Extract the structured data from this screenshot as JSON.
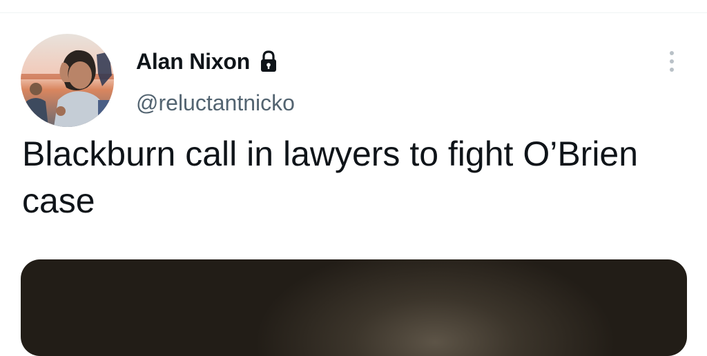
{
  "tweet": {
    "author": {
      "name": "Alan Nixon",
      "handle": "@reluctantnicko",
      "protected_icon": "lock-icon",
      "avatar": "profile-photo"
    },
    "more_icon": "more-vertical-icon",
    "text": "Blackburn call in lawyers to fight O’Brien case",
    "media": {
      "type": "photo"
    }
  },
  "colors": {
    "name_text": "#0f1419",
    "secondary_text": "#536471",
    "divider": "#eff3f4",
    "background": "#ffffff",
    "media_dark": "#221d17"
  }
}
